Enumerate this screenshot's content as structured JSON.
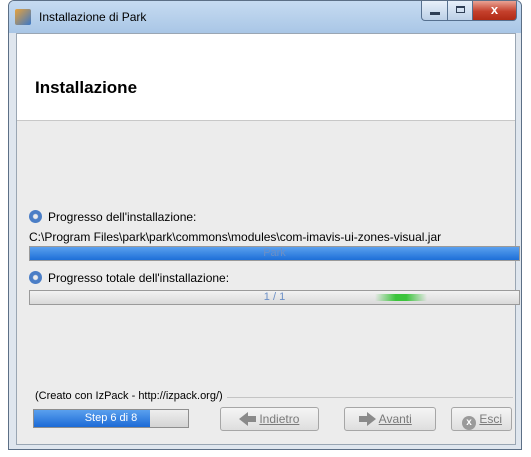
{
  "window": {
    "title": "Installazione di  Park",
    "close_glyph": "x"
  },
  "header": {
    "title": "Installazione"
  },
  "progress": {
    "install_label": "Progresso dell'installazione:",
    "file_path": "C:\\Program Files\\park\\park\\commons\\modules\\com-imavis-ui-zones-visual.jar",
    "install_bar_text": "Park",
    "install_fraction": 1.0,
    "total_label": "Progresso totale dell'installazione:",
    "total_bar_text": "1 / 1"
  },
  "footer": {
    "izpack_text": "(Creato con IzPack - http://izpack.org/)",
    "step_text": "Step 6 di 8",
    "step_fraction": 0.75,
    "back_label": "Indietro",
    "next_label": "Avanti",
    "exit_label": "Esci",
    "exit_glyph": "x"
  },
  "colors": {
    "progress_blue": "#2a78e0",
    "close_red": "#c4402c",
    "glow_green": "#3cc43c"
  },
  "icons": {
    "app": "package-icon",
    "progress": "gear-icon",
    "back": "arrow-left-icon",
    "next": "arrow-right-icon",
    "exit": "close-circle-icon"
  }
}
